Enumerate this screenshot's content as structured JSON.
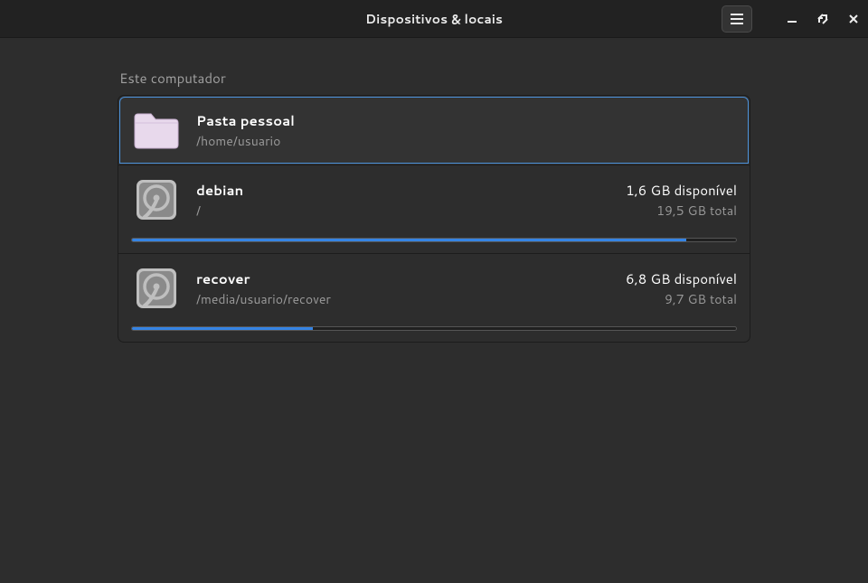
{
  "window": {
    "title": "Dispositivos & locais"
  },
  "section": {
    "header": "Este computador"
  },
  "items": [
    {
      "icon": "folder",
      "name": "Pasta pessoal",
      "path": "/home/usuario",
      "selected": true
    },
    {
      "icon": "hdd",
      "name": "debian",
      "path": "/",
      "available": "1,6 GB disponível",
      "total": "19,5 GB total",
      "usage_percent": 91.8
    },
    {
      "icon": "hdd",
      "name": "recover",
      "path": "/media/usuario/recover",
      "available": "6,8 GB disponível",
      "total": "9,7 GB total",
      "usage_percent": 29.9
    }
  ]
}
